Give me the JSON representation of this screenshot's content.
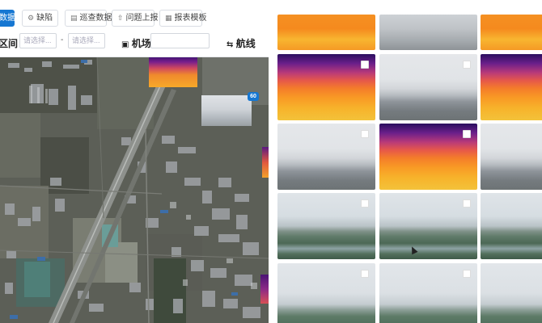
{
  "toolbar": {
    "first_button": "数据",
    "buttons": [
      {
        "label": "缺陷",
        "icon": "bug-icon"
      },
      {
        "label": "巡查数据",
        "icon": "table-icon"
      },
      {
        "label": "问题上报",
        "icon": "upload-icon"
      },
      {
        "label": "报表模板",
        "icon": "report-icon"
      }
    ]
  },
  "filter": {
    "range_label": "区间",
    "start_placeholder": "请选择...",
    "separator": "-",
    "end_placeholder": "请选择...",
    "airport_label": "机场",
    "route_label": "航线"
  },
  "map": {
    "thumbnail_badge": "60"
  },
  "gallery": {
    "colors": {
      "primary": "#1677d2",
      "accent_fire": "#f59022"
    },
    "items": [
      {
        "kind": "infrared",
        "checkbox": false
      },
      {
        "kind": "visible",
        "checkbox": false
      },
      {
        "kind": "infrared",
        "checkbox": false
      },
      {
        "kind": "infrared",
        "checkbox": true
      },
      {
        "kind": "visible",
        "checkbox": true
      },
      {
        "kind": "infrared",
        "checkbox": true
      },
      {
        "kind": "visible",
        "checkbox": true
      },
      {
        "kind": "infrared",
        "checkbox": true
      },
      {
        "kind": "visible",
        "checkbox": true
      },
      {
        "kind": "visible",
        "checkbox": true
      },
      {
        "kind": "visible",
        "checkbox": true
      },
      {
        "kind": "visible",
        "checkbox": true
      },
      {
        "kind": "visible",
        "checkbox": true
      },
      {
        "kind": "visible",
        "checkbox": true
      },
      {
        "kind": "visible",
        "checkbox": true
      }
    ]
  }
}
